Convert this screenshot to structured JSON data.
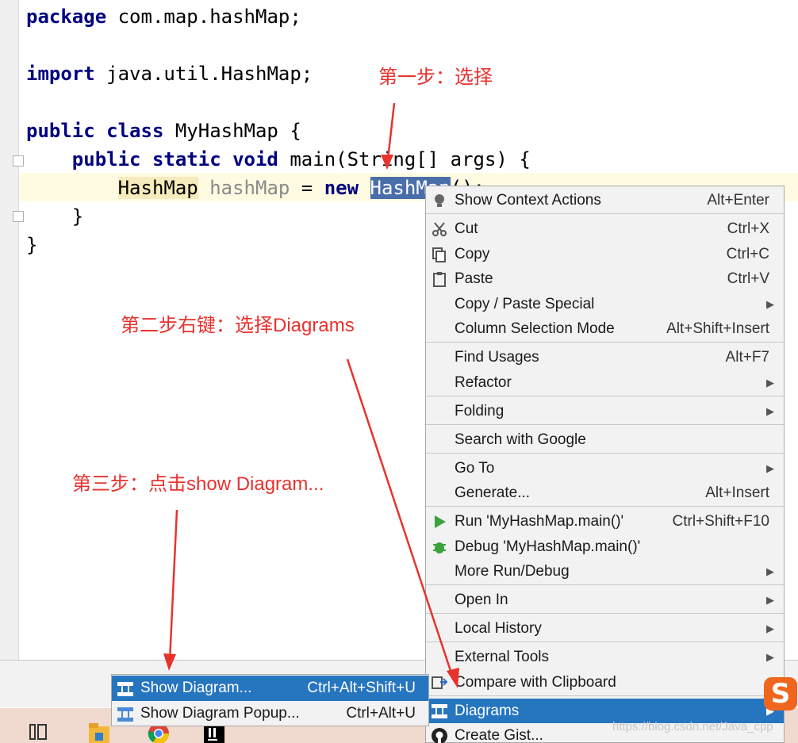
{
  "editor": {
    "lines": [
      {
        "kw": "package",
        "rest": " com.map.hashMap;"
      },
      {
        "kw": "import",
        "rest": " java.util.HashMap;"
      },
      {
        "kw": "public class",
        "rest": " MyHashMap {"
      },
      {
        "indent": "    ",
        "kw": "public static void",
        "rest": " main(String[] args) {"
      },
      {
        "indent": "        ",
        "type": "HashMap",
        "var": "hashMap",
        "op": " = ",
        "kw": "new",
        "sel": "HashMap",
        "rest": "();"
      },
      {
        "rest": "    }"
      },
      {
        "rest": "}"
      }
    ]
  },
  "annotations": {
    "step1": "第一步：选择",
    "step2": "第二步右键：选择Diagrams",
    "step3": "第三步：点击show Diagram..."
  },
  "context_menu": {
    "items": [
      {
        "label": "Show Context Actions",
        "shortcut": "Alt+Enter",
        "icon": "lightbulb-icon"
      },
      {
        "label": "Cut",
        "shortcut": "Ctrl+X",
        "icon": "scissors-icon"
      },
      {
        "label": "Copy",
        "shortcut": "Ctrl+C",
        "icon": "copy-icon"
      },
      {
        "label": "Paste",
        "shortcut": "Ctrl+V",
        "icon": "clipboard-icon"
      },
      {
        "label": "Copy / Paste Special",
        "submenu": true
      },
      {
        "label": "Column Selection Mode",
        "shortcut": "Alt+Shift+Insert"
      },
      {
        "label": "Find Usages",
        "shortcut": "Alt+F7"
      },
      {
        "label": "Refactor",
        "submenu": true
      },
      {
        "label": "Folding",
        "submenu": true
      },
      {
        "label": "Search with Google"
      },
      {
        "label": "Go To",
        "submenu": true
      },
      {
        "label": "Generate...",
        "shortcut": "Alt+Insert"
      },
      {
        "label": "Run 'MyHashMap.main()'",
        "shortcut": "Ctrl+Shift+F10",
        "icon": "run-icon"
      },
      {
        "label": "Debug 'MyHashMap.main()'",
        "icon": "debug-icon"
      },
      {
        "label": "More Run/Debug",
        "submenu": true
      },
      {
        "label": "Open In",
        "submenu": true
      },
      {
        "label": "Local History",
        "submenu": true
      },
      {
        "label": "External Tools",
        "submenu": true
      },
      {
        "label": "Compare with Clipboard",
        "icon": "compare-icon"
      },
      {
        "label": "Diagrams",
        "submenu": true,
        "active": true,
        "icon": "diagram-icon"
      },
      {
        "label": "Create Gist...",
        "icon": "github-icon"
      }
    ]
  },
  "submenu": {
    "items": [
      {
        "label": "Show Diagram...",
        "shortcut": "Ctrl+Alt+Shift+U",
        "active": true,
        "icon": "diagram-icon"
      },
      {
        "label": "Show Diagram Popup...",
        "shortcut": "Ctrl+Alt+U",
        "icon": "diagram-icon"
      }
    ]
  },
  "watermark": "https://blog.csdn.net/Java_cpp",
  "colors": {
    "accent": "#2675bf",
    "annotation": "#e8322e",
    "selection": "#4a6ea9",
    "keyword": "#000080"
  }
}
